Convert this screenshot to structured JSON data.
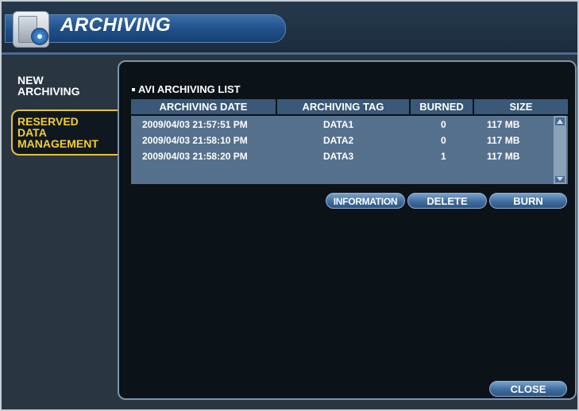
{
  "header": {
    "title": "ARCHIVING",
    "icon": "archive-safe-icon"
  },
  "nav": {
    "new_archiving": [
      "NEW",
      "ARCHIVING"
    ],
    "reserved": [
      "RESERVED",
      "DATA",
      "MANAGEMENT"
    ]
  },
  "list": {
    "title": "AVI ARCHIVING LIST",
    "columns": [
      "ARCHIVING DATE",
      "ARCHIVING TAG",
      "BURNED",
      "SIZE"
    ],
    "rows": [
      {
        "date": "2009/04/03 21:57:51 PM",
        "tag": "DATA1",
        "burned": "0",
        "size": "117 MB"
      },
      {
        "date": "2009/04/03 21:58:10 PM",
        "tag": "DATA2",
        "burned": "0",
        "size": "117 MB"
      },
      {
        "date": "2009/04/03 21:58:20 PM",
        "tag": "DATA3",
        "burned": "1",
        "size": "117 MB"
      }
    ]
  },
  "buttons": {
    "information": "INFORMATION",
    "delete": "DELETE",
    "burn": "BURN",
    "close": "CLOSE"
  },
  "colors": {
    "accent": "#f6cf2a",
    "header_blue": "#1f4f88",
    "table_body": "#56718d"
  }
}
